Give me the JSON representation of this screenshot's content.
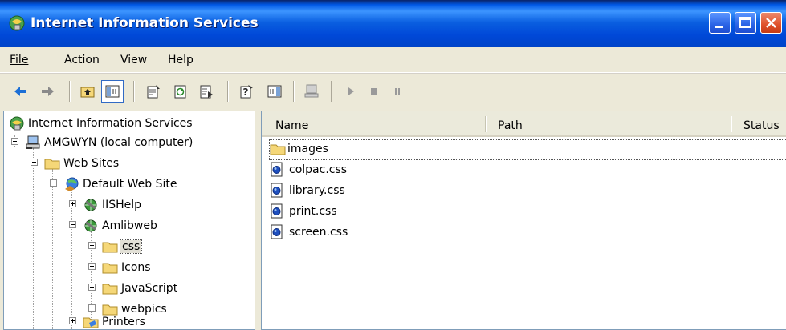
{
  "window": {
    "title": "Internet Information Services",
    "app_icon": "iis-icon"
  },
  "menu": [
    "File",
    "Action",
    "View",
    "Help"
  ],
  "toolbar": {
    "buttons": [
      "back-arrow-icon",
      "forward-arrow-icon",
      "up-folder-icon",
      "show-hide-console-tree-icon",
      "properties-icon",
      "refresh-icon",
      "export-list-icon",
      "help-icon",
      "action-pane-icon",
      "computer-icon",
      "start-icon",
      "stop-icon",
      "pause-icon"
    ]
  },
  "tree": {
    "root": "Internet Information Services",
    "computer": "AMGWYN (local computer)",
    "web_sites": "Web Sites",
    "default_site": "Default Web Site",
    "iishelp": "IISHelp",
    "amlibweb": "Amlibweb",
    "css": "css",
    "icons": "Icons",
    "javascript": "JavaScript",
    "webpics": "webpics",
    "printers": "Printers"
  },
  "list": {
    "columns": [
      "Name",
      "Path",
      "Status"
    ],
    "rows": [
      {
        "name": "images",
        "type": "folder"
      },
      {
        "name": "colpac.css",
        "type": "file"
      },
      {
        "name": "library.css",
        "type": "file"
      },
      {
        "name": "print.css",
        "type": "file"
      },
      {
        "name": "screen.css",
        "type": "file"
      }
    ]
  },
  "colors": {
    "titlebar": "#0058e6",
    "folder": "#f5d778",
    "window_bg": "#ece9d8"
  }
}
